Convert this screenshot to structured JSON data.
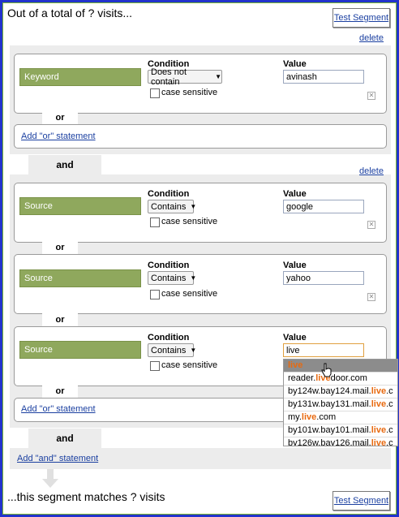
{
  "header": {
    "title": "Out of a total of ? visits...",
    "test_label": "Test Segment"
  },
  "footer": {
    "title": "...this segment matches ? visits",
    "test_label": "Test Segment"
  },
  "common": {
    "delete": "delete",
    "condition": "Condition",
    "value": "Value",
    "case_sensitive": "case sensitive",
    "or": "or",
    "and": "and"
  },
  "group1": {
    "rule1": {
      "dimension": "Keyword",
      "condition": "Does not contain",
      "value": "avinash"
    },
    "add_or": "Add \"or\" statement"
  },
  "group2": {
    "rule1": {
      "dimension": "Source",
      "condition": "Contains",
      "value": "google"
    },
    "rule2": {
      "dimension": "Source",
      "condition": "Contains",
      "value": "yahoo"
    },
    "rule3": {
      "dimension": "Source",
      "condition": "Contains",
      "value": "live"
    },
    "add_or": "Add \"or\" statement"
  },
  "add_and": "Add \"and\" statement",
  "autocomplete": {
    "items": [
      {
        "pre": "",
        "hl": "live",
        "post": ""
      },
      {
        "pre": "reader.",
        "hl": "live",
        "post": "door.com"
      },
      {
        "pre": "by124w.bay124.mail.",
        "hl": "live",
        "post": ".c"
      },
      {
        "pre": "by131w.bay131.mail.",
        "hl": "live",
        "post": ".c"
      },
      {
        "pre": "my.",
        "hl": "live",
        "post": ".com"
      },
      {
        "pre": "by101w.bay101.mail.",
        "hl": "live",
        "post": ".c"
      },
      {
        "pre": "by126w.bay126.mail.",
        "hl": "live",
        "post": ".c"
      }
    ]
  },
  "colors": {
    "frame": "#2233cc",
    "dimension": "#8fa85d",
    "link": "#1a3fa0",
    "highlight": "#e86a10"
  }
}
